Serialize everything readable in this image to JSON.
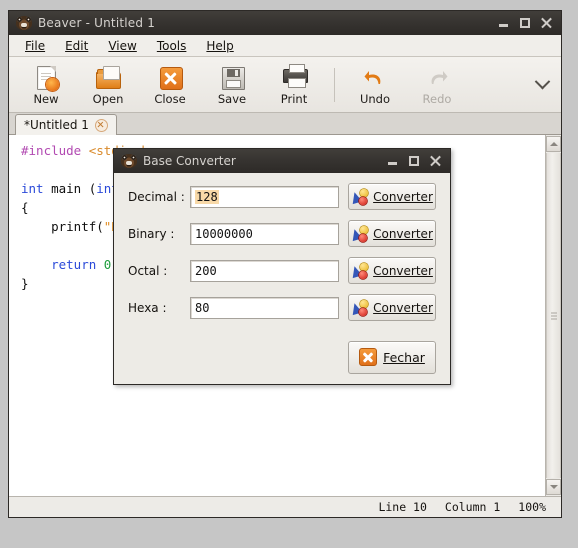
{
  "window": {
    "title": "Beaver - Untitled 1",
    "icon": "beaver-icon",
    "buttons": {
      "minimize": "minimize",
      "maximize": "maximize",
      "close": "close"
    }
  },
  "menubar": {
    "items": [
      {
        "label": "File",
        "mnemonic": "F"
      },
      {
        "label": "Edit",
        "mnemonic": "E"
      },
      {
        "label": "View",
        "mnemonic": "V"
      },
      {
        "label": "Tools",
        "mnemonic": "T"
      },
      {
        "label": "Help",
        "mnemonic": "H"
      }
    ]
  },
  "toolbar": {
    "buttons": [
      {
        "label": "New",
        "icon": "new-document-icon",
        "enabled": true
      },
      {
        "label": "Open",
        "icon": "open-folder-icon",
        "enabled": true
      },
      {
        "label": "Close",
        "icon": "close-x-icon",
        "enabled": true
      },
      {
        "label": "Save",
        "icon": "floppy-disk-icon",
        "enabled": true
      },
      {
        "label": "Print",
        "icon": "printer-icon",
        "enabled": true
      },
      {
        "label": "Undo",
        "icon": "undo-arrow-icon",
        "enabled": true
      },
      {
        "label": "Redo",
        "icon": "redo-arrow-icon",
        "enabled": false
      }
    ],
    "overflow_icon": "chevron-down-icon"
  },
  "tabs": [
    {
      "label": "*Untitled 1",
      "active": true,
      "close_icon": "tab-close-icon"
    }
  ],
  "editor": {
    "lines": [
      {
        "segments": [
          {
            "text": "#include ",
            "cls": "k-pre"
          },
          {
            "text": "<stdio.h>",
            "cls": "k-inc"
          }
        ]
      },
      {
        "segments": [
          {
            "text": "",
            "cls": ""
          }
        ]
      },
      {
        "segments": [
          {
            "text": "int",
            "cls": "k-kw"
          },
          {
            "text": " main (",
            "cls": ""
          },
          {
            "text": "int",
            "cls": "k-kw"
          }
        ]
      },
      {
        "segments": [
          {
            "text": "{",
            "cls": ""
          }
        ]
      },
      {
        "segments": [
          {
            "text": "    printf(",
            "cls": ""
          },
          {
            "text": "\"He",
            "cls": "k-str"
          }
        ]
      },
      {
        "segments": [
          {
            "text": "",
            "cls": ""
          }
        ]
      },
      {
        "segments": [
          {
            "text": "    ",
            "cls": ""
          },
          {
            "text": "return",
            "cls": "k-kw"
          },
          {
            "text": " ",
            "cls": ""
          },
          {
            "text": "0",
            "cls": "k-num"
          },
          {
            "text": ";",
            "cls": ""
          }
        ]
      },
      {
        "segments": [
          {
            "text": "}",
            "cls": ""
          }
        ]
      }
    ],
    "scrollbar": {
      "up_icon": "scroll-up-arrow-icon",
      "down_icon": "scroll-down-arrow-icon"
    }
  },
  "statusbar": {
    "line": "Line 10",
    "column": "Column 1",
    "zoom": "100%"
  },
  "dialog": {
    "title": "Base Converter",
    "icon": "beaver-icon",
    "buttons": {
      "minimize": "minimize",
      "maximize": "maximize",
      "close": "close"
    },
    "rows": [
      {
        "label": "Decimal :",
        "value": "128",
        "selected": true,
        "button": "Converter",
        "button_mnemonic": "C",
        "button_icon": "converter-icon"
      },
      {
        "label": "Binary :",
        "value": "10000000",
        "selected": false,
        "button": "Converter",
        "button_mnemonic": "C",
        "button_icon": "converter-icon"
      },
      {
        "label": "Octal :",
        "value": "200",
        "selected": false,
        "button": "Converter",
        "button_mnemonic": "C",
        "button_icon": "converter-icon"
      },
      {
        "label": "Hexa :",
        "value": "80",
        "selected": false,
        "button": "Converter",
        "button_mnemonic": "C",
        "button_icon": "converter-icon"
      }
    ],
    "close_button": {
      "label": "Fechar",
      "mnemonic": "F",
      "icon": "close-x-icon"
    }
  },
  "colors": {
    "accent_orange": "#e0701a",
    "titlebar": "#35322f",
    "chrome": "#edebe6",
    "selection": "#f8d9a8",
    "keyword_blue": "#2b4ad9",
    "string_orange": "#e08a1e",
    "preproc_purple": "#b24ab2",
    "number_green": "#1f9e3e"
  }
}
